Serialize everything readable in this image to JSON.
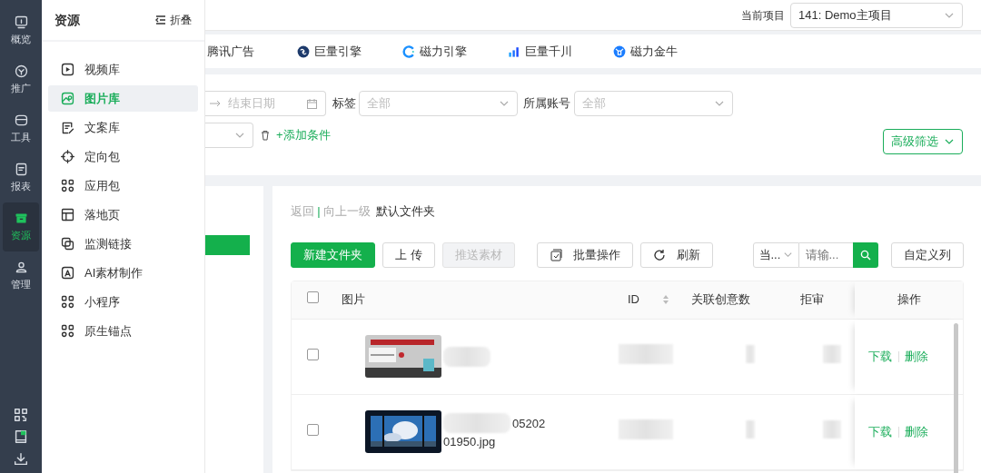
{
  "rail": {
    "items": [
      {
        "label": "概览",
        "selected": false
      },
      {
        "label": "推广",
        "selected": false
      },
      {
        "label": "工具",
        "selected": false
      },
      {
        "label": "报表",
        "selected": false
      },
      {
        "label": "资源",
        "selected": true
      },
      {
        "label": "管理",
        "selected": false
      }
    ]
  },
  "drawer": {
    "title": "资源",
    "collapse_label": "折叠",
    "items": [
      {
        "label": "视频库",
        "selected": false
      },
      {
        "label": "图片库",
        "selected": true
      },
      {
        "label": "文案库",
        "selected": false
      },
      {
        "label": "定向包",
        "selected": false
      },
      {
        "label": "应用包",
        "selected": false
      },
      {
        "label": "落地页",
        "selected": false
      },
      {
        "label": "监测链接",
        "selected": false
      },
      {
        "label": "AI素材制作",
        "selected": false
      },
      {
        "label": "小程序",
        "selected": false
      },
      {
        "label": "原生锚点",
        "selected": false
      }
    ]
  },
  "header": {
    "project_label": "当前项目",
    "project_value": "141: Demo主项目"
  },
  "platforms": [
    {
      "label": "腾讯广告"
    },
    {
      "label": "巨量引擎"
    },
    {
      "label": "磁力引擎"
    },
    {
      "label": "巨量千川"
    },
    {
      "label": "磁力金牛"
    }
  ],
  "filters": {
    "end_date_placeholder": "结束日期",
    "tag_label": "标签",
    "tag_value": "全部",
    "account_label": "所属账号",
    "account_value": "全部",
    "add_condition": "+添加条件",
    "advanced_filter": "高级筛选"
  },
  "breadcrumb": {
    "back": "返回",
    "separator": "|",
    "up": "向上一级",
    "current": "默认文件夹"
  },
  "toolbar": {
    "buttons": [
      {
        "label": "新建文件夹",
        "kind": "primary"
      },
      {
        "label": "上 传",
        "kind": "default"
      },
      {
        "label": "推送素材",
        "kind": "disabled"
      },
      {
        "label": "批量操作",
        "kind": "batch"
      },
      {
        "label": "刷新",
        "kind": "refresh"
      }
    ],
    "search_scope": "当...",
    "search_placeholder": "请输...",
    "custom_columns": "自定义列"
  },
  "table": {
    "columns": [
      {
        "label": "图片",
        "sortable": false
      },
      {
        "label": "ID",
        "sortable": true
      },
      {
        "label": "关联创意数",
        "sortable": false
      },
      {
        "label": "拒审",
        "sortable": false
      },
      {
        "label": "操作",
        "sortable": false
      }
    ],
    "header_checked": false,
    "rows": [
      {
        "checked": false,
        "name_lines": [],
        "download": "下载",
        "delete": "删除"
      },
      {
        "checked": false,
        "name_lines": [
          "05202",
          "01950.jpg"
        ],
        "download": "下载",
        "delete": "删除"
      }
    ]
  }
}
